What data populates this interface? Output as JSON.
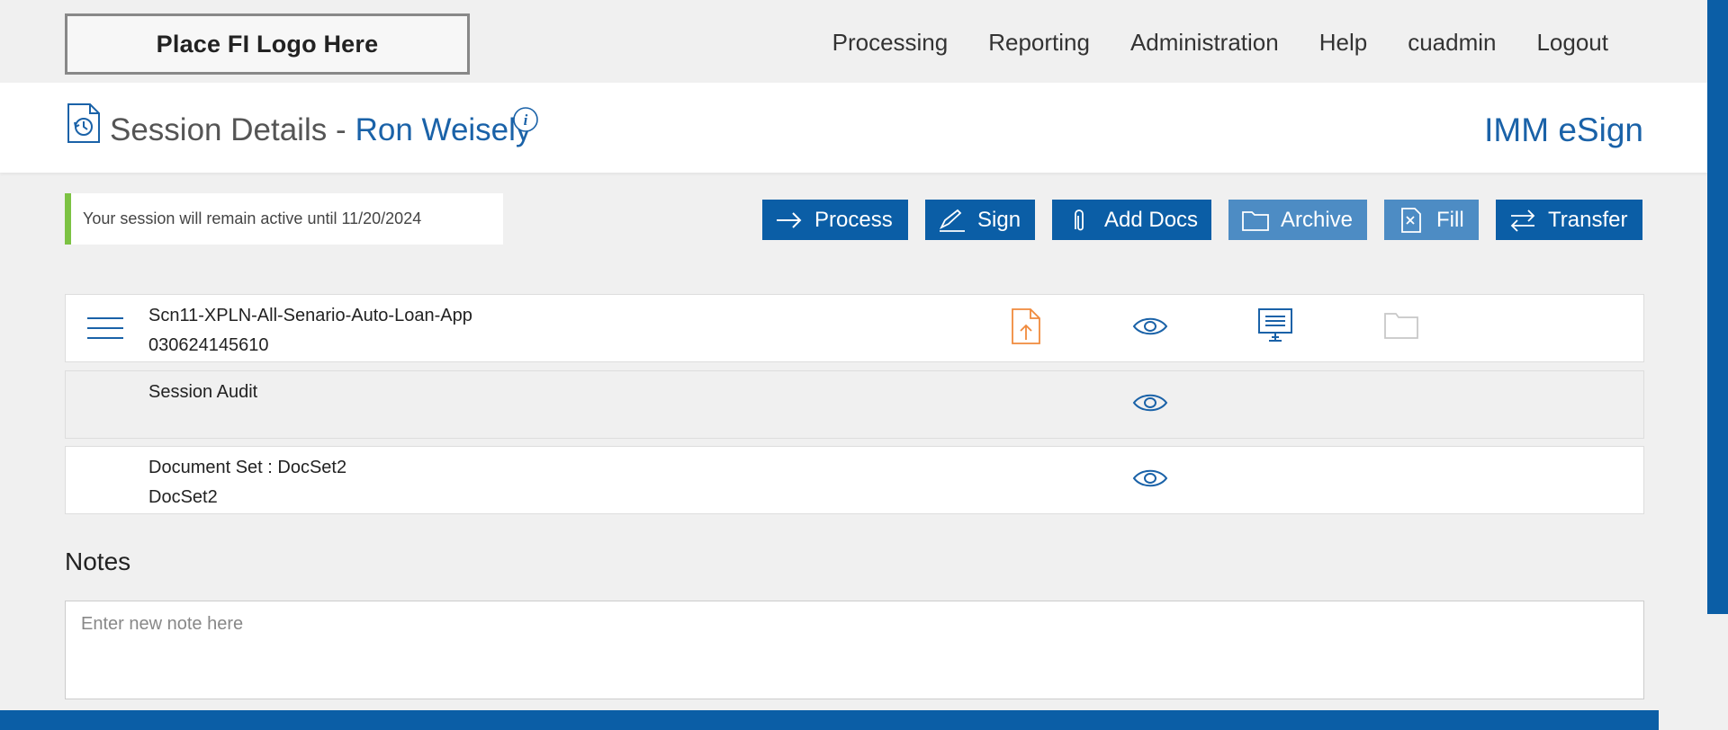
{
  "header": {
    "logo_text": "Place FI Logo Here",
    "nav": [
      "Processing",
      "Reporting",
      "Administration",
      "Help",
      "cuadmin",
      "Logout"
    ]
  },
  "titlebar": {
    "title": "Session Details -",
    "name": "Ron Weisely",
    "brand": "IMM eSign"
  },
  "notice": "Your session will remain active until 11/20/2024",
  "actions": {
    "process": "Process",
    "sign": "Sign",
    "add_docs": "Add Docs",
    "archive": "Archive",
    "fill": "Fill",
    "transfer": "Transfer"
  },
  "rows": [
    {
      "line1": "Scn11-XPLN-All-Senario-Auto-Loan-App",
      "line2": "030624145610"
    },
    {
      "line1": "Session Audit",
      "line2": ""
    },
    {
      "line1": "Document Set : DocSet2",
      "line2": "DocSet2"
    }
  ],
  "notes": {
    "title": "Notes",
    "placeholder": "Enter new note here"
  },
  "colors": {
    "primary": "#0b5ea6",
    "primary_light": "#4d8cc4",
    "accent_green": "#7cc243",
    "upload_orange": "#f08a3c",
    "link_blue": "#1a62a8"
  }
}
